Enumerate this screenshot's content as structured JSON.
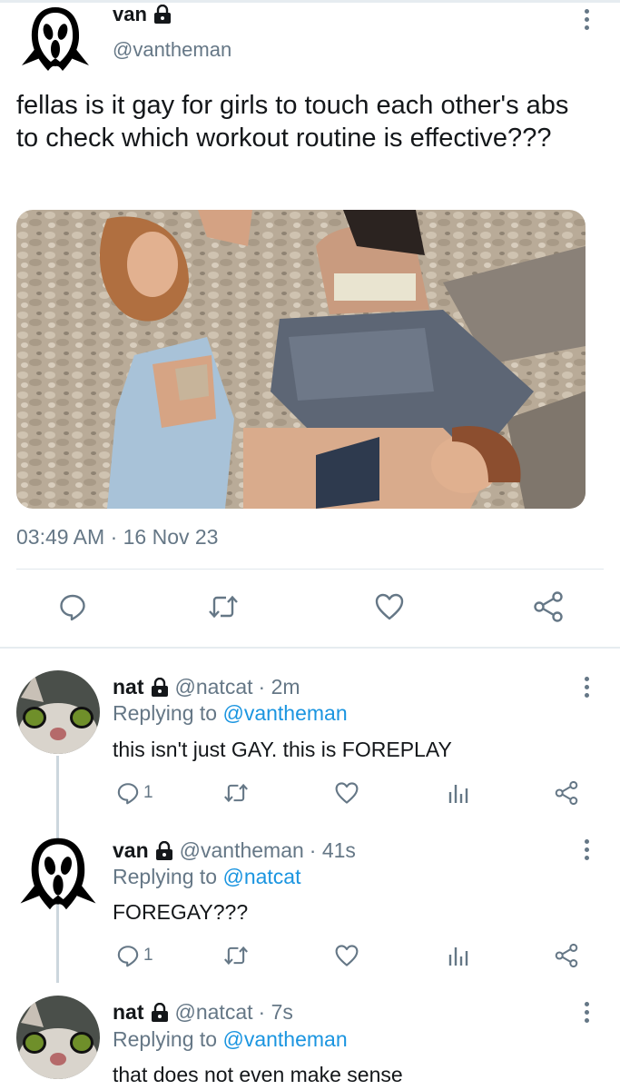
{
  "tweet": {
    "name": "van",
    "handle": "@vantheman",
    "text": "fellas is it gay for girls to touch each other's abs to check which workout routine is effective???",
    "timestamp": "03:49 AM · 16 Nov 23"
  },
  "replies": [
    {
      "name": "nat",
      "handle": "@natcat",
      "time": "· 2m",
      "replying_prefix": "Replying to",
      "replying_to": "@vantheman",
      "text": "this isn't just GAY. this is FOREPLAY",
      "reply_count": "1"
    },
    {
      "name": "van",
      "handle": "@vantheman",
      "time": "· 41s",
      "replying_prefix": "Replying to",
      "replying_to": "@natcat",
      "text": "FOREGAY???",
      "reply_count": "1"
    },
    {
      "name": "nat",
      "handle": "@natcat",
      "time": "· 7s",
      "replying_prefix": "Replying to",
      "replying_to": "@vantheman",
      "text": "that does not even make sense"
    }
  ],
  "icons": {
    "main_actions": [
      "reply-icon",
      "retweet-icon",
      "like-icon",
      "share-icon"
    ],
    "reply_actions": [
      "reply-icon",
      "retweet-icon",
      "like-icon",
      "analytics-icon",
      "share-icon"
    ],
    "account": "lock-icon",
    "menu": "more-vertical-icon"
  },
  "colors": {
    "text": "#14171a",
    "secondary": "#657786",
    "link": "#1b95e0",
    "divider": "#e1e8ed"
  }
}
